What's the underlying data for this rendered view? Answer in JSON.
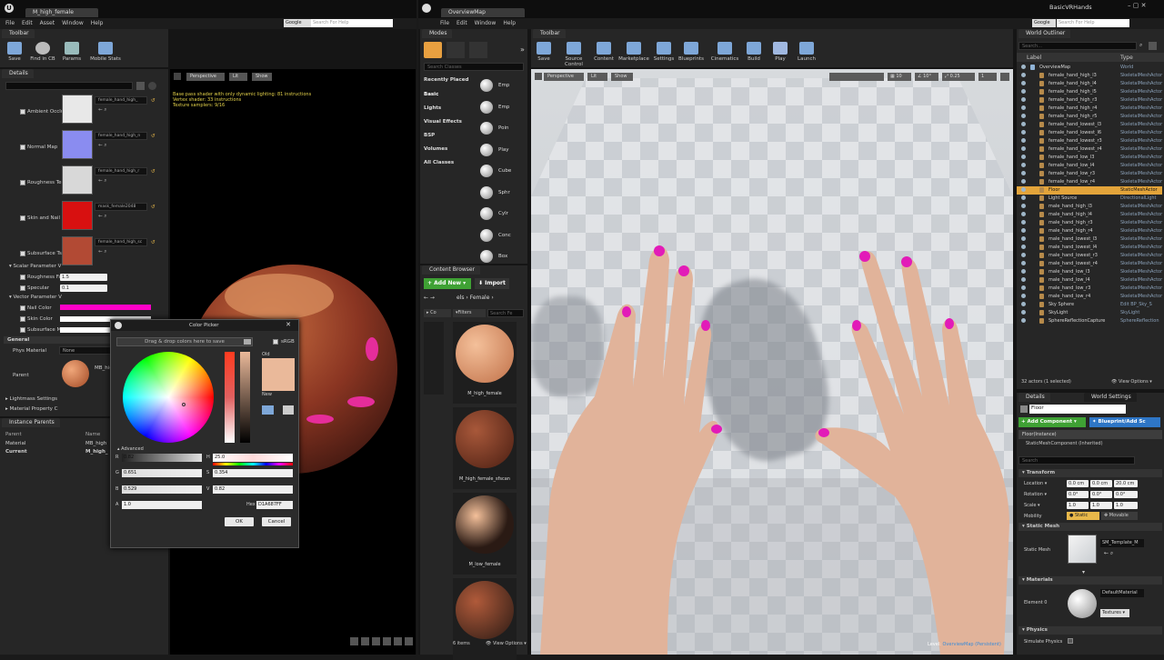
{
  "left_window": {
    "tab_title": "M_high_female",
    "toolbar_tab": "Toolbar",
    "menu": [
      "File",
      "Edit",
      "Asset",
      "Window",
      "Help"
    ],
    "search_brand": "Google",
    "search_placeholder": "Search For Help",
    "toolbar": [
      {
        "label": "Save",
        "icon": "save-icon"
      },
      {
        "label": "Find in CB",
        "icon": "find-in-cb-icon"
      },
      {
        "label": "Params",
        "icon": "params-icon"
      },
      {
        "label": "Mobile Stats",
        "icon": "mobile-stats-icon"
      }
    ],
    "details_tab": "Details",
    "texture_params": [
      {
        "label": "Ambient Occlu",
        "asset": "female_hand_high_",
        "color": "#e8e8e8"
      },
      {
        "label": "Normal Map",
        "asset": "female_hand_high_n",
        "color": "#8a8cf0"
      },
      {
        "label": "Roughness Te",
        "asset": "female_hand_high_r",
        "color": "#d8d8d8"
      },
      {
        "label": "Skin and Nail",
        "asset": "mask_female2048",
        "color": "#d81010"
      },
      {
        "label": "Subsurface Ts",
        "asset": "female_hand_high_sc",
        "color": "#b24a34"
      }
    ],
    "scalar_group": "Scalar Parameter V",
    "scalars": [
      {
        "label": "Roughness Fa",
        "value": "1.5"
      },
      {
        "label": "Specular",
        "value": "0.1"
      }
    ],
    "vector_group": "Vector Parameter V",
    "vectors": [
      {
        "label": "Nail Color",
        "color": "#ff00c8"
      },
      {
        "label": "Skin Color",
        "color": "#ffffff"
      },
      {
        "label": "Subsurface M",
        "color": "#ffffff"
      }
    ],
    "general_group": "General",
    "phys_material_label": "Phys Material",
    "phys_material_value": "None",
    "parent_label": "Parent",
    "parent_value": "MB_high",
    "lightmass": "Lightmass Settings",
    "material_property": "Material Property C",
    "instance_parents_tab": "Instance Parents",
    "instance_parents": {
      "headers": [
        "Parent",
        "Name"
      ],
      "rows": [
        [
          "Material",
          "MB_high"
        ],
        [
          "Current",
          "M_high_"
        ]
      ]
    },
    "viewport": {
      "perspective": "Perspective",
      "lit": "Lit",
      "show": "Show",
      "stats": [
        "Base pass shader with only dynamic lighting: 81 instructions",
        "Vertex shader: 33 instructions",
        "Texture samplers: 9/16"
      ]
    }
  },
  "color_picker": {
    "title": "Color Picker",
    "hint": "Drag & drop colors here to save",
    "srgb": "sRGB",
    "old_label": "Old",
    "new_label": "New",
    "advanced": "Advanced",
    "r": "0.82",
    "g": "0.651",
    "b": "0.529",
    "a": "1.0",
    "h": "25.0",
    "s": "0.354",
    "v": "0.82",
    "hex_label": "Hex",
    "hex": "D1A687FF",
    "ok": "OK",
    "cancel": "Cancel",
    "old_color": "#eab99a",
    "new_color": "#eab99a"
  },
  "main_window": {
    "tab_title": "OverviewMap",
    "project_name": "BasicVRHands",
    "menu": [
      "File",
      "Edit",
      "Window",
      "Help"
    ],
    "search_brand": "Google",
    "search_placeholder": "Search For Help",
    "modes_tab": "Modes",
    "search_classes": "Search Classes",
    "categories": [
      "Recently Placed",
      "Basic",
      "Lights",
      "Visual Effects",
      "BSP",
      "Volumes",
      "All Classes"
    ],
    "placeables": [
      "Emp",
      "Emp",
      "Poin",
      "Play",
      "Cube",
      "Sphr",
      "Cylr",
      "Conc",
      "Box"
    ],
    "content_browser_tab": "Content Browser",
    "add_new": "Add New",
    "import": "Import",
    "path": [
      "els",
      "Female"
    ],
    "filters": "Filters",
    "search_content": "Search Fe",
    "assets": [
      {
        "name": "M_high_female"
      },
      {
        "name": "M_high_female_sfscan"
      },
      {
        "name": "M_low_female"
      },
      {
        "name": ""
      }
    ],
    "items_count": "6 items",
    "view_options": "View Options",
    "toolbar_tab": "Toolbar",
    "toolbar": [
      {
        "label": "Save",
        "icon": "save-icon"
      },
      {
        "label": "Source Control",
        "icon": "source-control-icon"
      },
      {
        "label": "Content",
        "icon": "content-icon"
      },
      {
        "label": "Marketplace",
        "icon": "marketplace-icon"
      },
      {
        "label": "Settings",
        "icon": "settings-icon"
      },
      {
        "label": "Blueprints",
        "icon": "blueprints-icon"
      },
      {
        "label": "Cinematics",
        "icon": "cinematics-icon"
      },
      {
        "label": "Build",
        "icon": "build-icon"
      },
      {
        "label": "Play",
        "icon": "play-icon"
      },
      {
        "label": "Launch",
        "icon": "launch-icon"
      }
    ],
    "viewport": {
      "perspective": "Perspective",
      "lit": "Lit",
      "show": "Show",
      "grid": "10",
      "angle": "10°",
      "scale": "0.25",
      "cam": "1",
      "level_label": "Level:",
      "level_name": "OverviewMap (Persistent)"
    }
  },
  "world_outliner": {
    "tab": "World Outliner",
    "search": "Search...",
    "col_label": "Label",
    "col_type": "Type",
    "rows": [
      {
        "name": "OverviewMap",
        "type": "World"
      },
      {
        "name": "female_hand_high_l3",
        "type": "SkeletalMeshActor"
      },
      {
        "name": "female_hand_high_l4",
        "type": "SkeletalMeshActor"
      },
      {
        "name": "female_hand_high_l5",
        "type": "SkeletalMeshActor"
      },
      {
        "name": "female_hand_high_r3",
        "type": "SkeletalMeshActor"
      },
      {
        "name": "female_hand_high_r4",
        "type": "SkeletalMeshActor"
      },
      {
        "name": "female_hand_high_r5",
        "type": "SkeletalMeshActor"
      },
      {
        "name": "female_hand_lowest_l3",
        "type": "SkeletalMeshActor"
      },
      {
        "name": "female_hand_lowest_l6",
        "type": "SkeletalMeshActor"
      },
      {
        "name": "female_hand_lowest_r3",
        "type": "SkeletalMeshActor"
      },
      {
        "name": "female_hand_lowest_r4",
        "type": "SkeletalMeshActor"
      },
      {
        "name": "female_hand_low_l3",
        "type": "SkeletalMeshActor"
      },
      {
        "name": "female_hand_low_l4",
        "type": "SkeletalMeshActor"
      },
      {
        "name": "female_hand_low_r3",
        "type": "SkeletalMeshActor"
      },
      {
        "name": "female_hand_low_r4",
        "type": "SkeletalMeshActor"
      },
      {
        "name": "Floor",
        "type": "StaticMeshActor"
      },
      {
        "name": "Light Source",
        "type": "DirectionalLight"
      },
      {
        "name": "male_hand_high_l3",
        "type": "SkeletalMeshActor"
      },
      {
        "name": "male_hand_high_l4",
        "type": "SkeletalMeshActor"
      },
      {
        "name": "male_hand_high_r3",
        "type": "SkeletalMeshActor"
      },
      {
        "name": "male_hand_high_r4",
        "type": "SkeletalMeshActor"
      },
      {
        "name": "male_hand_lowest_l3",
        "type": "SkeletalMeshActor"
      },
      {
        "name": "male_hand_lowest_l4",
        "type": "SkeletalMeshActor"
      },
      {
        "name": "male_hand_lowest_r3",
        "type": "SkeletalMeshActor"
      },
      {
        "name": "male_hand_lowest_r4",
        "type": "SkeletalMeshActor"
      },
      {
        "name": "male_hand_low_l3",
        "type": "SkeletalMeshActor"
      },
      {
        "name": "male_hand_low_l4",
        "type": "SkeletalMeshActor"
      },
      {
        "name": "male_hand_low_r3",
        "type": "SkeletalMeshActor"
      },
      {
        "name": "male_hand_low_r4",
        "type": "SkeletalMeshActor"
      },
      {
        "name": "Sky Sphere",
        "type": "Edit BP_Sky_S"
      },
      {
        "name": "SkyLight",
        "type": "SkyLight"
      },
      {
        "name": "SphereReflectionCapture",
        "type": "SphereReflection"
      }
    ],
    "selected_index": 15,
    "actors_count": "32 actors (1 selected)",
    "view_options": "View Options"
  },
  "details": {
    "tab": "Details",
    "world_settings_tab": "World Settings",
    "name_value": "Floor",
    "add_component": "Add Component",
    "blueprint": "Blueprint/Add Sc",
    "instance": "Floor(Instance)",
    "component": "StaticMeshComponent (Inherited)",
    "search": "Search",
    "transform": "Transform",
    "location_label": "Location",
    "location": [
      "0.0 cm",
      "0.0 cm",
      "20.0 cm"
    ],
    "rotation_label": "Rotation",
    "rotation": [
      "0.0°",
      "0.0°",
      "0.0°"
    ],
    "scale_label": "Scale",
    "scale": [
      "1.0",
      "1.0",
      "1.0"
    ],
    "mobility_label": "Mobility",
    "static": "Static",
    "movable": "Movable",
    "static_mesh_group": "Static Mesh",
    "static_mesh_label": "Static Mesh",
    "static_mesh_value": "SM_Template_M",
    "materials_group": "Materials",
    "element_label": "Element 0",
    "element_value": "DefaultMaterial",
    "textures": "Textures",
    "physics_group": "Physics",
    "simulate_physics": "Simulate Physics"
  }
}
